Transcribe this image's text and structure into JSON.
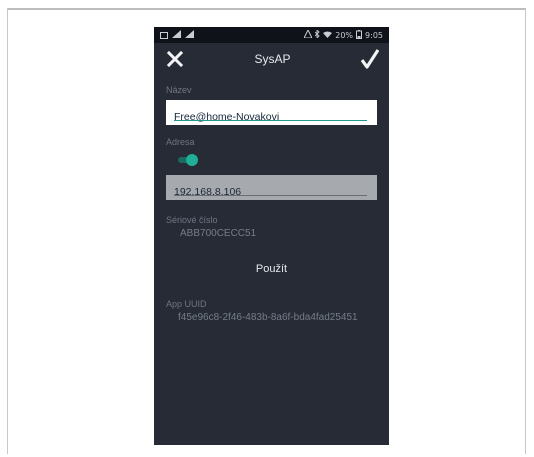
{
  "status_bar": {
    "left_icons": [
      "gallery-icon",
      "signal-icon",
      "signal-icon"
    ],
    "battery": "20%",
    "time": "9:05"
  },
  "app_bar": {
    "title": "SysAP",
    "close_icon": "close-icon",
    "confirm_icon": "check-icon"
  },
  "form": {
    "name_label": "Název",
    "name_value": "Free@home-Novakovi",
    "address_label": "Adresa",
    "address_toggle_on": true,
    "address_value": "192.168.8.106",
    "serial_label": "Sériové číslo",
    "serial_value": "ABB700CECC51",
    "apply_label": "Použít",
    "uuid_label": "App UUID",
    "uuid_value": "f45e96c8-2f46-483b-8a6f-bda4fad25451"
  },
  "colors": {
    "background": "#262b36",
    "accent": "#1fae96",
    "statusbar": "#0f1218"
  }
}
